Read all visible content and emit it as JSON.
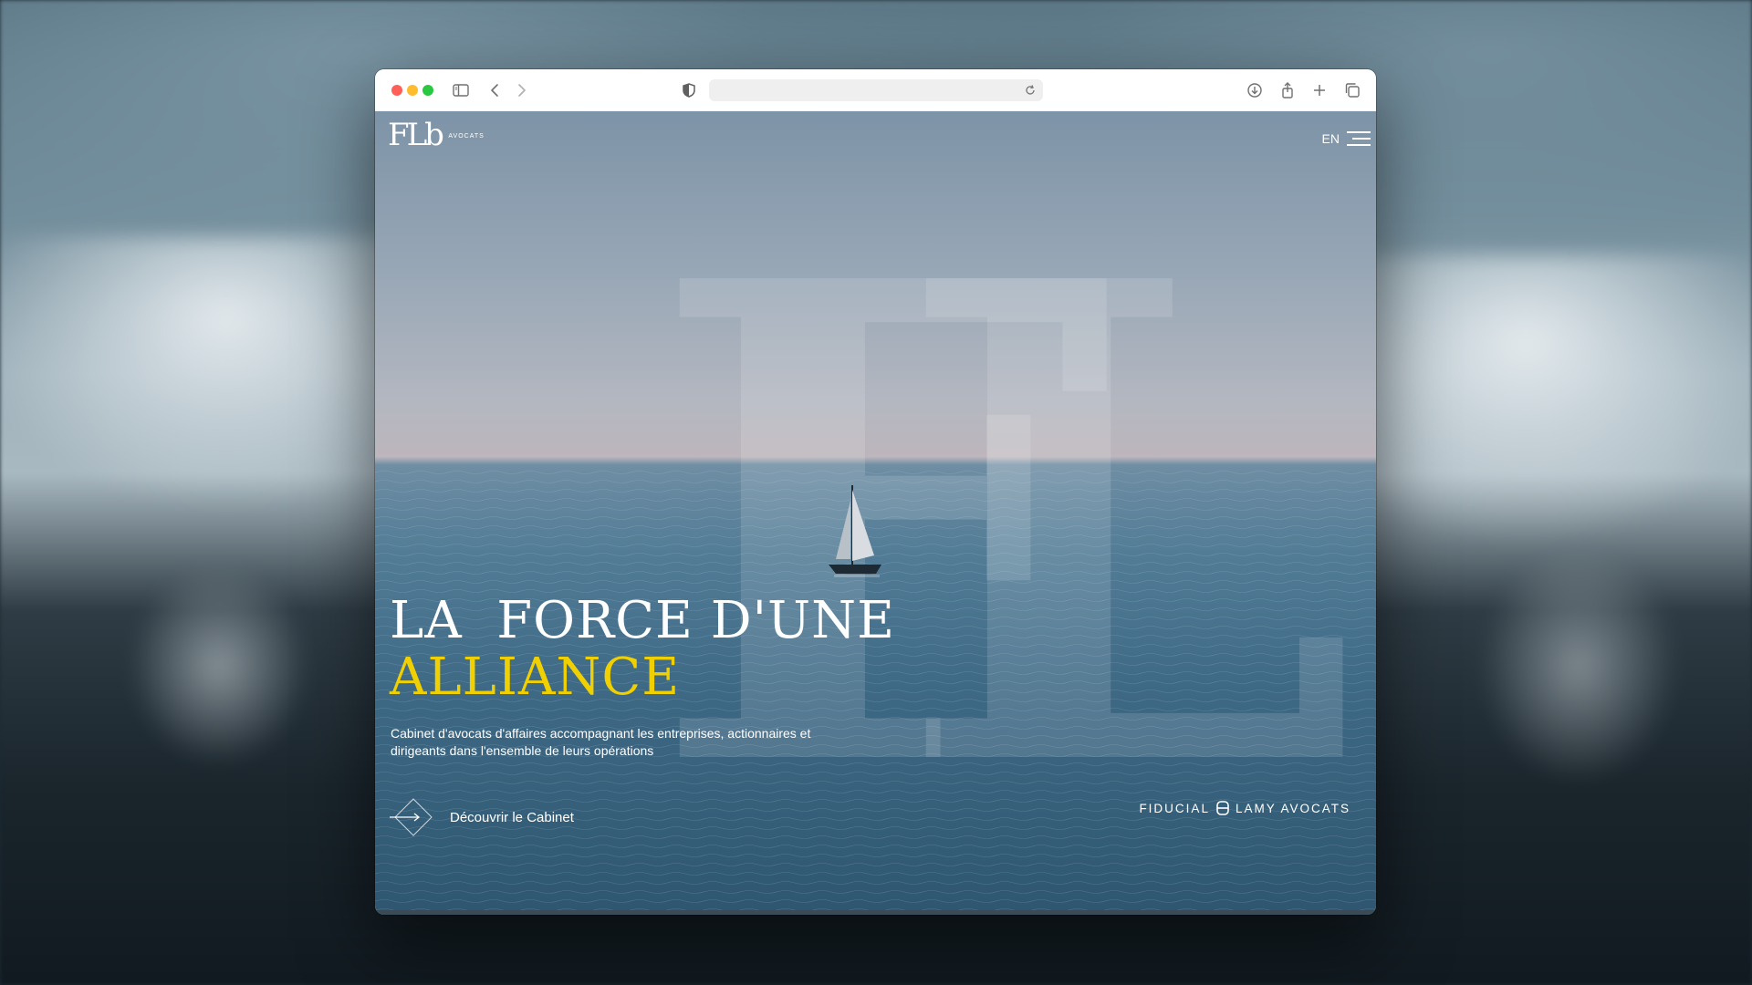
{
  "browser": {
    "address_value": "",
    "buttons": [
      "close",
      "minimize",
      "zoom",
      "sidebar",
      "back",
      "forward",
      "privacy-shield",
      "reload",
      "downloads",
      "share",
      "new-tab",
      "tab-overview"
    ]
  },
  "site": {
    "logo_monogram": "FLb",
    "logo_text": "AVOCATS",
    "lang_label": "EN",
    "headline_line1": "LA  FORCE D'UNE",
    "headline_line2": "ALLIANCE",
    "description": "Cabinet d'avocats d'affaires accompagnant les entreprises, actionnaires et dirigeants dans l'ensemble de leurs opérations",
    "cta_label": "Découvrir le Cabinet",
    "partner_left": "FIDUCIAL",
    "partner_right": "LAMY AVOCATS"
  },
  "colors": {
    "accent_yellow": "#f0d000",
    "text_white": "#ffffff"
  }
}
